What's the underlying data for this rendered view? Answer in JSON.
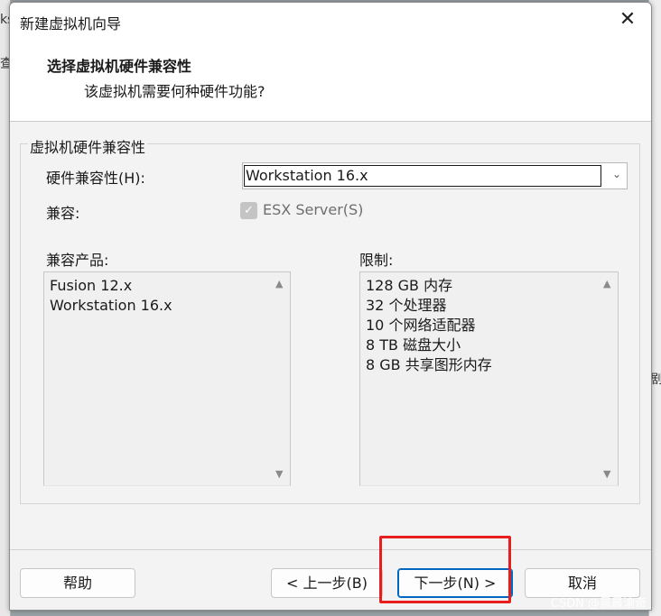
{
  "background": {
    "left_fragments": [
      "ks",
      "查"
    ],
    "right_fragment": "剧"
  },
  "dialog": {
    "title": "新建虚拟机向导",
    "close_icon": "close-icon",
    "header": {
      "title": "选择虚拟机硬件兼容性",
      "subtitle": "该虚拟机需要何种硬件功能?"
    },
    "group": {
      "legend": "虚拟机硬件兼容性",
      "hardware_compat_label": "硬件兼容性(H):",
      "hardware_compat_value": "Workstation 16.x",
      "compatible_label": "兼容:",
      "esx_checkbox_label": "ESX Server(S)",
      "esx_checked": true,
      "products_label": "兼容产品:",
      "products": [
        "Fusion 12.x",
        "Workstation 16.x"
      ],
      "limits_label": "限制:",
      "limits": [
        "128 GB 内存",
        "32 个处理器",
        "10 个网络适配器",
        "8 TB 磁盘大小",
        "8 GB 共享图形内存"
      ]
    },
    "buttons": {
      "help": "帮助",
      "back": "< 上一步(B)",
      "next": "下一步(N) >",
      "cancel": "取消"
    }
  },
  "watermark": "CSDN @晨晨渝奇",
  "colors": {
    "highlight": "#e81e1e",
    "primary_border": "#0067c0"
  }
}
